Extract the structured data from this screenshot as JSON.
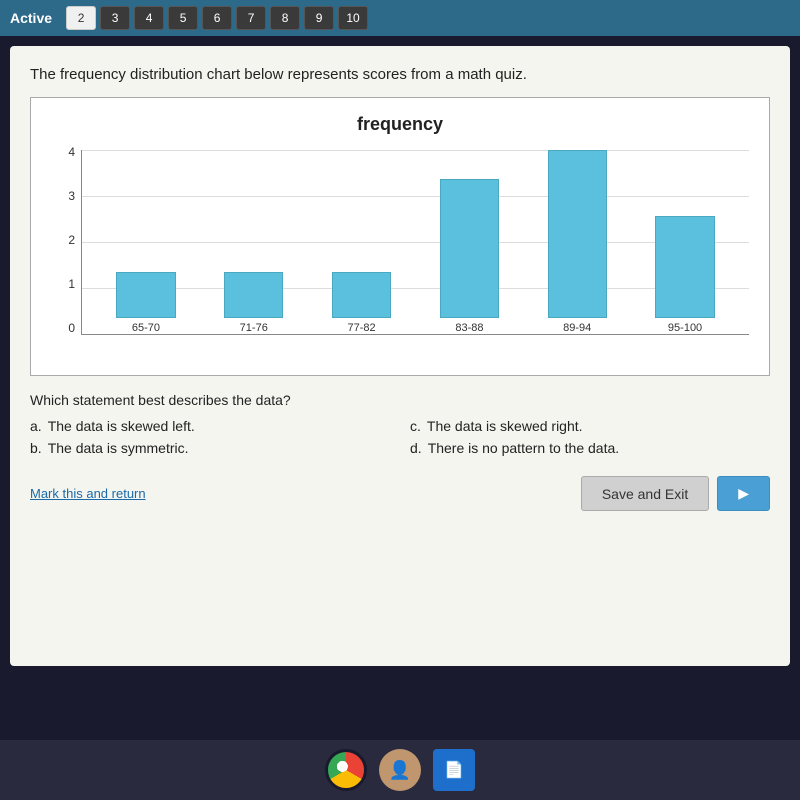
{
  "topbar": {
    "title": "Active",
    "tabs": [
      {
        "label": "2",
        "active": true
      },
      {
        "label": "3",
        "active": false
      },
      {
        "label": "4",
        "active": false
      },
      {
        "label": "5",
        "active": false
      },
      {
        "label": "6",
        "active": false
      },
      {
        "label": "7",
        "active": false
      },
      {
        "label": "8",
        "active": false
      },
      {
        "label": "9",
        "active": false
      },
      {
        "label": "10",
        "active": false
      }
    ]
  },
  "question": {
    "text": "The frequency distribution chart below represents scores from a math quiz.",
    "chart": {
      "title": "frequency",
      "y_axis_labels": [
        "0",
        "1",
        "2",
        "3",
        "4"
      ],
      "bars": [
        {
          "label": "65-70",
          "value": 1
        },
        {
          "label": "71-76",
          "value": 1
        },
        {
          "label": "77-82",
          "value": 1
        },
        {
          "label": "83-88",
          "value": 3
        },
        {
          "label": "89-94",
          "value": 4
        },
        {
          "label": "95-100",
          "value": 2.2
        }
      ],
      "max_value": 4
    },
    "prompt": "Which statement best describes the data?",
    "answers": [
      {
        "key": "a.",
        "text": "The data is skewed left."
      },
      {
        "key": "b.",
        "text": "The data is symmetric."
      },
      {
        "key": "c.",
        "text": "The data is skewed right."
      },
      {
        "key": "d.",
        "text": "There is no pattern to the data."
      }
    ]
  },
  "actions": {
    "mark_return": "Mark this and return",
    "save_exit": "Save and Exit"
  }
}
